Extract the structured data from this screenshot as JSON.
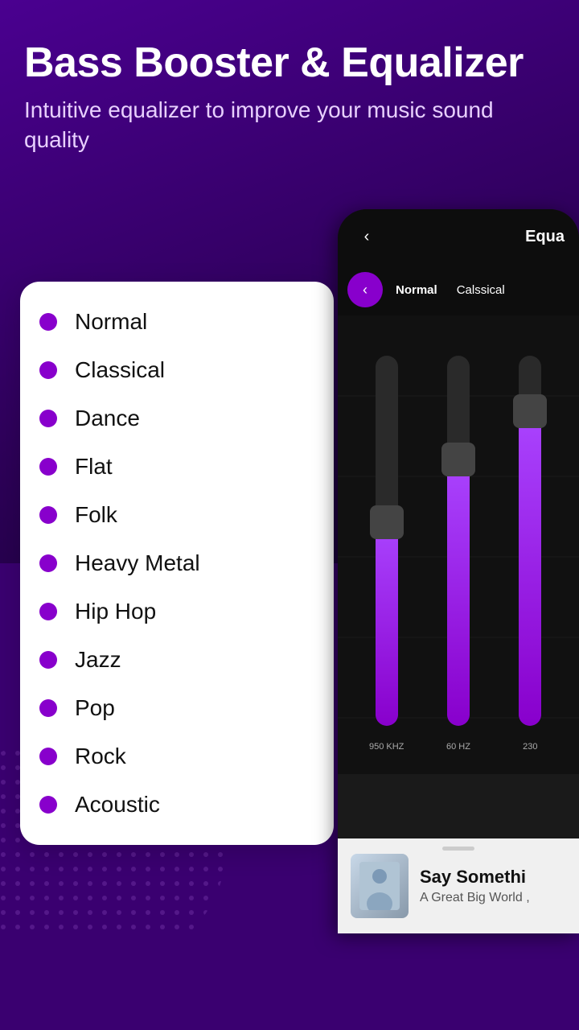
{
  "header": {
    "title": "Bass Booster & Equalizer",
    "subtitle": "Intuitive equalizer to improve your music sound quality"
  },
  "presets": {
    "items": [
      {
        "label": "Normal"
      },
      {
        "label": "Classical"
      },
      {
        "label": "Dance"
      },
      {
        "label": "Flat"
      },
      {
        "label": "Folk"
      },
      {
        "label": "Heavy Metal"
      },
      {
        "label": "Hip Hop"
      },
      {
        "label": "Jazz"
      },
      {
        "label": "Pop"
      },
      {
        "label": "Rock"
      },
      {
        "label": "Acoustic"
      }
    ]
  },
  "phone": {
    "header_title": "Equa",
    "back_label": "<",
    "eq_tabs": [
      "Normal",
      "Calssical"
    ],
    "slider_labels": [
      "950 KHZ",
      "60 HZ",
      "230"
    ],
    "player": {
      "title": "Say Somethi",
      "artist": "A Great Big World ,"
    }
  },
  "colors": {
    "accent": "#8800cc",
    "background": "#3a0070"
  }
}
